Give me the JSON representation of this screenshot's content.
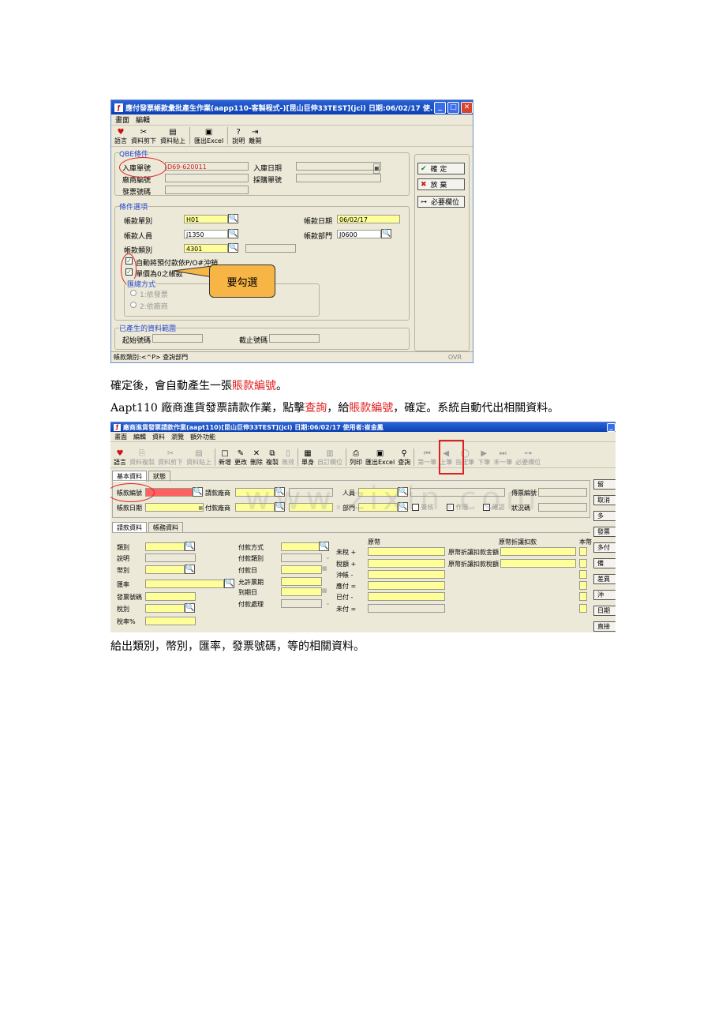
{
  "win1": {
    "title": "應付發票帳款彙批產生作業(aapp110-客製程式-)[昆山巨伸33TEST](jci) 日期:06/02/17 使...",
    "menu": [
      "畫面",
      "編輯"
    ],
    "tools": [
      {
        "icon": "heart-icon",
        "label": "語言"
      },
      {
        "icon": "scissors-icon",
        "label": "資料剪下"
      },
      {
        "icon": "paste-icon",
        "label": "資料貼上"
      },
      {
        "icon": "excel-icon",
        "label": "匯出Excel"
      },
      {
        "icon": "help-icon",
        "label": "說明"
      },
      {
        "icon": "exit-icon",
        "label": "離開"
      }
    ],
    "qbe": {
      "title": "QBE條件",
      "receipt_no_label": "入庫單號",
      "receipt_no_value": "D69-620011",
      "receipt_date_label": "入庫日期",
      "vendor_label": "廠商編號",
      "po_label": "採購單號",
      "invoice_label": "發票號碼"
    },
    "options": {
      "title": "條件選項",
      "ap_type_label": "帳款單別",
      "ap_type_value": "H01",
      "ap_date_label": "帳款日期",
      "ap_date_value": "06/02/17",
      "ap_person_label": "帳款人員",
      "ap_person_value": "j1350",
      "ap_dept_label": "帳款部門",
      "ap_dept_value": "J0600",
      "ap_class_label": "帳款類別",
      "ap_class_value": "4301",
      "chk1_label": "自動將預付款依P/O#沖銷",
      "chk2_label": "單價為0之帳款",
      "sum_title": "匯總方式",
      "radio1": "1:依發票",
      "radio2": "2:依廠商"
    },
    "generated": {
      "title": "已產生的資料範圍",
      "start_label": "起始號碼",
      "end_label": "截止號碼"
    },
    "buttons": {
      "ok": "確 定",
      "cancel": "放 棄",
      "required": "必要欄位"
    },
    "status_left": "帳款類別:<^P> 查詢部門",
    "status_right": "OVR",
    "callout": "要勾選"
  },
  "para1": {
    "prefix": "確定後，會自動產生一張",
    "red": "賬款編號",
    "suffix": "。"
  },
  "para2": {
    "p1": "Aapt110 廠商進貨發票請款作業，點擊",
    "red1": "查詢",
    "p2": "，給",
    "red2": "賬款編號",
    "p3": "，確定。系統自動代出相關資料。"
  },
  "win2": {
    "title": "廠商進貨發票請款作業(aapt110)[昆山巨伸33TEST](jci) 日期:06/02/17 使用者:崔金鳳",
    "menu": [
      "畫面",
      "編輯",
      "資料",
      "瀏覽",
      "額外功能"
    ],
    "tools": [
      {
        "icon": "heart-icon",
        "label": "語言",
        "dis": false
      },
      {
        "icon": "copy-icon",
        "label": "資料複製",
        "dis": true
      },
      {
        "icon": "scissors-icon",
        "label": "資料剪下",
        "dis": true
      },
      {
        "icon": "paste-icon",
        "label": "資料貼上",
        "dis": true
      },
      {
        "icon": "new-icon",
        "label": "新增",
        "dis": false
      },
      {
        "icon": "edit-icon",
        "label": "更改",
        "dis": false
      },
      {
        "icon": "delete-icon",
        "label": "刪除",
        "dis": false
      },
      {
        "icon": "duplicate-icon",
        "label": "複製",
        "dis": false
      },
      {
        "icon": "void-icon",
        "label": "無效",
        "dis": true
      },
      {
        "icon": "header-icon",
        "label": "單身",
        "dis": false
      },
      {
        "icon": "custom-icon",
        "label": "自訂欄位",
        "dis": true
      },
      {
        "icon": "print-icon",
        "label": "列印",
        "dis": false
      },
      {
        "icon": "excel-icon",
        "label": "匯出Excel",
        "dis": false
      },
      {
        "icon": "binoculars-icon",
        "label": "查詢",
        "dis": false
      },
      {
        "icon": "first-icon",
        "label": "第一筆",
        "dis": true
      },
      {
        "icon": "prev-icon",
        "label": "上筆",
        "dis": true
      },
      {
        "icon": "goto-icon",
        "label": "指定筆",
        "dis": true
      },
      {
        "icon": "next-icon",
        "label": "下筆",
        "dis": true
      },
      {
        "icon": "last-icon",
        "label": "末一筆",
        "dis": true
      },
      {
        "icon": "key-icon",
        "label": "必要欄位",
        "dis": true
      }
    ],
    "tabs": [
      "基本資料",
      "狀態"
    ],
    "header": {
      "ap_no": "帳款編號",
      "pay_vendor": "請款廠商",
      "person": "人員",
      "source_no": "傳票編號",
      "ap_date": "帳款日期",
      "pay_vendor2": "付款廠商",
      "dept": "部門",
      "audit": "簽核",
      "posted": "作廢",
      "confirmed": "確認",
      "status_code": "狀況碼"
    },
    "subtabs": [
      "請款資料",
      "帳務資料"
    ],
    "left": [
      "類別",
      "說明",
      "幣別",
      "匯率",
      "發票號碼",
      "稅別",
      "稅率%"
    ],
    "mid": [
      "付款方式",
      "付款類別",
      "付款日",
      "允許票期",
      "到期日",
      "付款處理"
    ],
    "orig_title": "原幣",
    "sums": [
      "未稅 +",
      "稅額 +",
      "沖帳 -",
      "應付 =",
      "已付 -",
      "未付 ="
    ],
    "disc_title": "原幣折讓扣款",
    "disc1": "原幣折讓扣款金額",
    "disc2": "原幣折讓扣款稅額",
    "local": "本幣",
    "side": [
      "留",
      "取消",
      "多",
      "發票",
      "多付",
      "備",
      "差異",
      "沖",
      "日期",
      "直接"
    ]
  },
  "para3": "給出類別，幣別，匯率，發票號碼，等的相關資料。",
  "watermark": "www.zixin.com"
}
